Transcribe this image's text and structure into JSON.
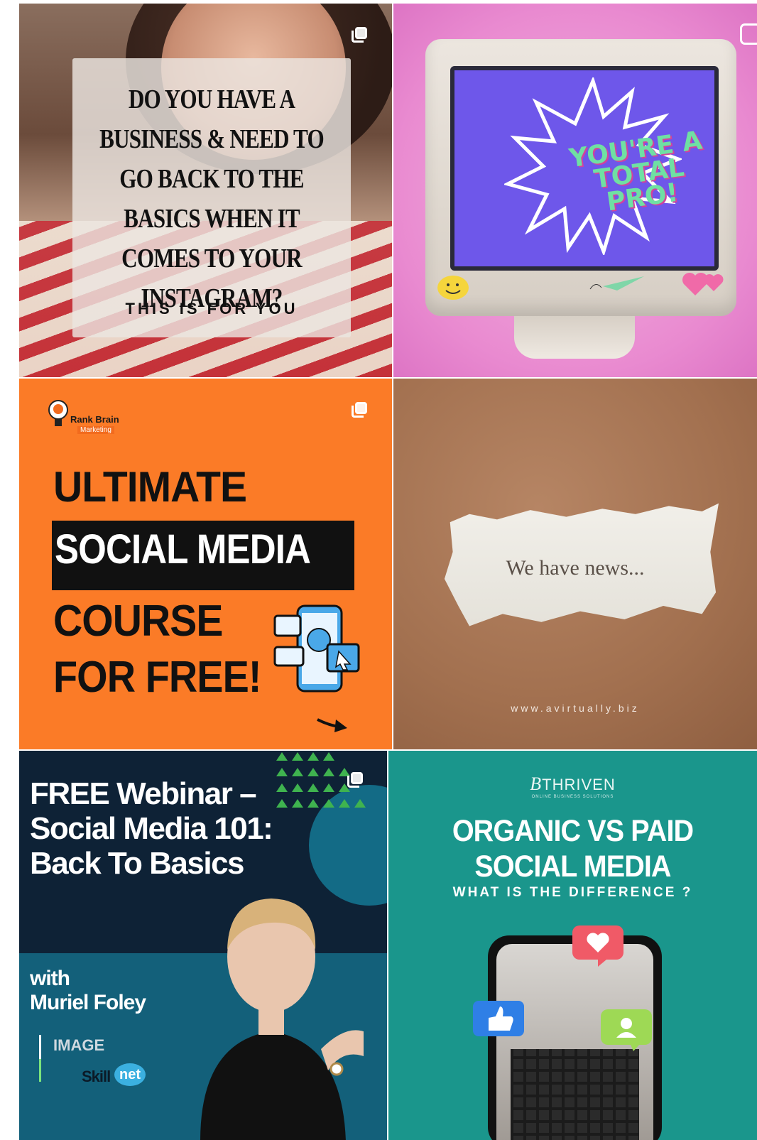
{
  "tiles": {
    "t1": {
      "headline": "DO YOU HAVE A BUSINESS & NEED TO GO BACK TO THE BASICS WHEN IT COMES TO YOUR INSTAGRAM?",
      "sub": "THIS IS FOR YOU",
      "icon": "multiple-posts-icon"
    },
    "t2": {
      "screen_text": "YOU'RE A TOTAL PRO!",
      "icon": "reels-icon"
    },
    "t3": {
      "brand_name": "Rank Brain",
      "brand_sub": "Marketing",
      "line1": "ULTIMATE",
      "line2": "SOCIAL MEDIA",
      "line3": "COURSE",
      "line4": "FOR FREE!",
      "icon": "multiple-posts-icon"
    },
    "t4": {
      "note": "We have news...",
      "url": "www.avirtually.biz"
    },
    "t5": {
      "title": "FREE Webinar – Social Media 101: Back To Basics",
      "with": "with",
      "host": "Muriel Foley",
      "logo1": "IMAGE",
      "logo2": "Skill",
      "logo3": "net",
      "icon": "multiple-posts-icon"
    },
    "t6": {
      "brand": "THRIVEN",
      "brand_prefix": "B",
      "brand_sub": "ONLINE BUSINESS SOLUTIONS",
      "heading1": "ORGANIC VS PAID",
      "heading2": "SOCIAL MEDIA",
      "subheading": "WHAT IS THE DIFFERENCE ?"
    }
  },
  "colors": {
    "t3_bg": "#fb7b27",
    "t6_bg": "#1a968c",
    "t5_bg": "#0e2236",
    "t2_screen": "#6e57ea"
  }
}
